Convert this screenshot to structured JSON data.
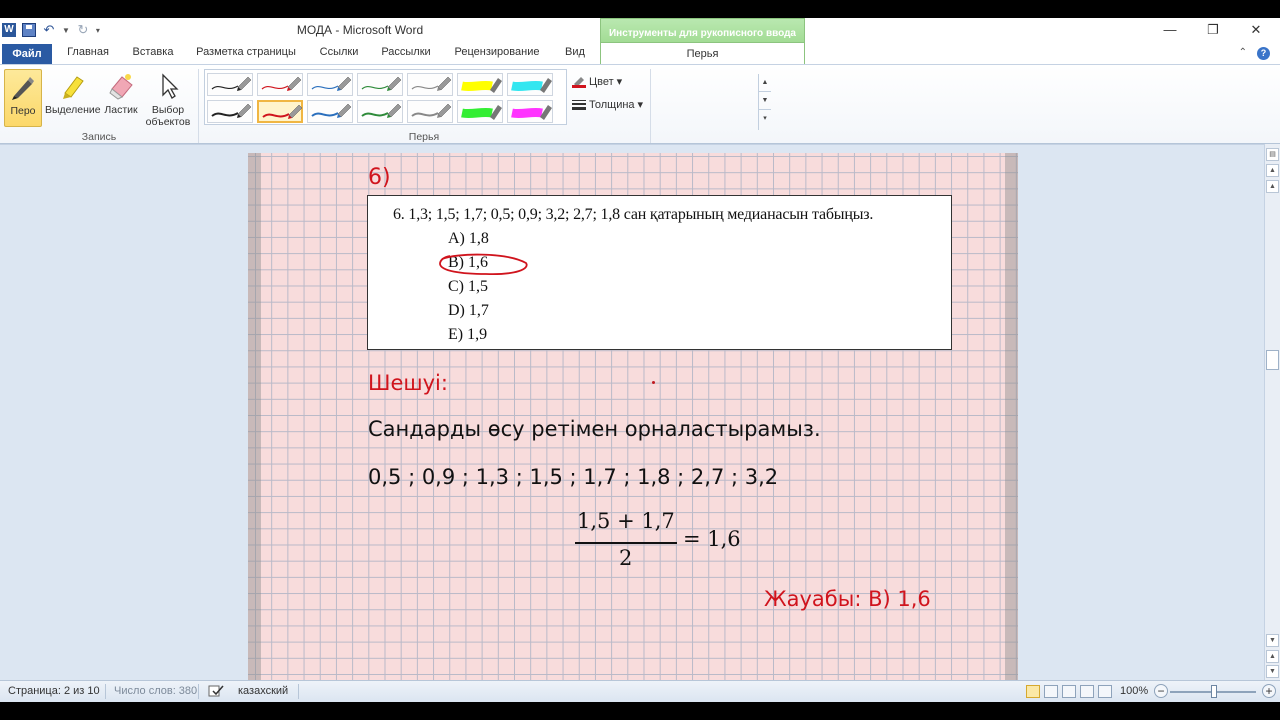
{
  "window": {
    "title": "МОДА  -  Microsoft Word",
    "contextual_group": "Инструменты для рукописного ввода",
    "minimize": "—",
    "restore": "❐",
    "close": "✕",
    "qat_word": "W",
    "qat_more": "▾"
  },
  "tabs": {
    "file": "Файл",
    "home": "Главная",
    "insert": "Вставка",
    "layout": "Разметка страницы",
    "references": "Ссылки",
    "mailings": "Рассылки",
    "review": "Рецензирование",
    "view": "Вид",
    "pens": "Перья",
    "help_min": "⌃",
    "help_q": "?"
  },
  "ribbon": {
    "pen": "Перо",
    "highlight": "Выделение",
    "eraser": "Ластик",
    "select_line1": "Выбор",
    "select_line2": "объектов",
    "group_record": "Запись",
    "group_pens": "Перья",
    "color": "Цвет",
    "thickness": "Толщина",
    "dropdown": "▾",
    "pen_colors": {
      "row1": [
        "#222222",
        "#d0141d",
        "#2a6fbd",
        "#2e8b3a",
        "#888888",
        "#ffff00",
        "#33e6f0"
      ],
      "row2": [
        "#222222",
        "#d0141d",
        "#2a6fbd",
        "#2e8b3a",
        "#888888",
        "#33ee33",
        "#ff33ff"
      ]
    },
    "selected_pen": "row2-1"
  },
  "document": {
    "section_label": "6)",
    "problem": "6.   1,3; 1,5; 1,7; 0,5; 0,9; 3,2; 2,7; 1,8 сан қатарының медианасын табыңыз.",
    "options": [
      "A)  1,8",
      "B)  1,6",
      "C)  1,5",
      "D)  1,7",
      "E)  1,9"
    ],
    "solution_label": "Шешуі:",
    "instruction": "Сандарды өсу ретімен орналастырамыз.",
    "sorted": "0,5 ; 0,9 ; 1,3 ; 1,5 ; 1,7 ; 1,8 ; 2,7 ; 3,2",
    "formula_numerator": "1,5 +  1,7",
    "formula_denominator": "2",
    "formula_result": "= 1,6",
    "answer": "Жауабы: В) 1,6",
    "accent_color": "#d0141d"
  },
  "statusbar": {
    "page": "Страница: 2 из 10",
    "words": "Число слов: 380",
    "language": "казахский",
    "zoom": "100%",
    "zoom_minus": "−",
    "zoom_plus": "+"
  }
}
